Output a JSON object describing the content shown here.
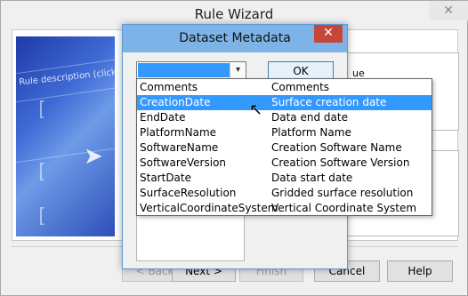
{
  "rule_wizard": {
    "title": "Rule Wizard",
    "close_glyph": "✕",
    "image_description_text": "Rule description (click on",
    "right_box_text": "ue",
    "buttons": {
      "back": "< Back",
      "next": "Next >",
      "finish": "Finish",
      "cancel": "Cancel",
      "help": "Help"
    }
  },
  "dataset_metadata": {
    "title": "Dataset Metadata",
    "close_glyph": "✕",
    "combo_arrow": "▾",
    "ok_label": "OK",
    "options": [
      {
        "name": "Comments",
        "description": "Comments",
        "selected": false
      },
      {
        "name": "CreationDate",
        "description": "Surface creation date",
        "selected": true
      },
      {
        "name": "EndDate",
        "description": "Data end date",
        "selected": false
      },
      {
        "name": "PlatformName",
        "description": "Platform Name",
        "selected": false
      },
      {
        "name": "SoftwareName",
        "description": "Creation Software Name",
        "selected": false
      },
      {
        "name": "SoftwareVersion",
        "description": "Creation Software Version",
        "selected": false
      },
      {
        "name": "StartDate",
        "description": "Data start date",
        "selected": false
      },
      {
        "name": "SurfaceResolution",
        "description": "Gridded surface resolution",
        "selected": false
      },
      {
        "name": "VerticalCoordinateSystem",
        "description": "Vertical Coordinate System",
        "selected": false
      }
    ]
  },
  "colors": {
    "selection": "#3399ff",
    "dialog_titlebar": "#7db3e6",
    "close_button": "#c7463b"
  }
}
